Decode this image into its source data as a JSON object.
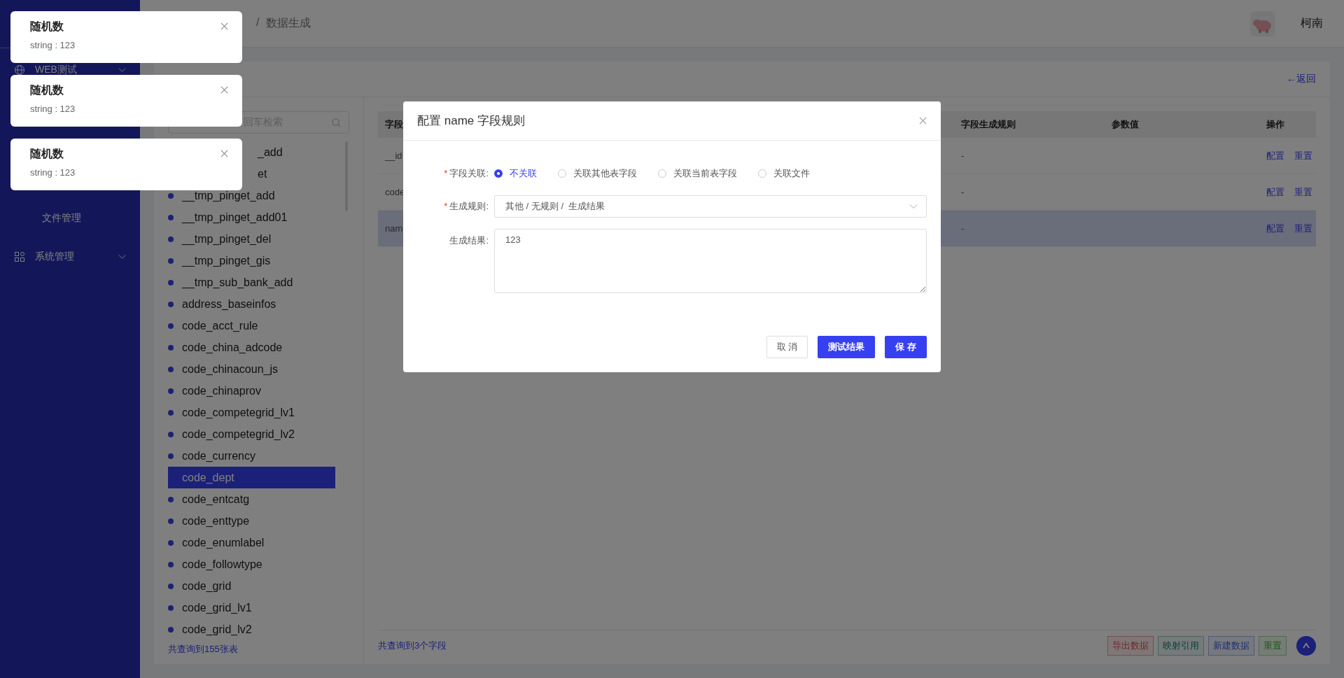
{
  "header": {
    "breadcrumb": [
      "/",
      "数据生成"
    ],
    "user": "柯南"
  },
  "sidebar": {
    "items": [
      {
        "label": "WEB测试",
        "kind": "group",
        "expanded": false
      },
      {
        "label": "文件管理",
        "kind": "leaf"
      },
      {
        "label": "系统管理",
        "kind": "group",
        "expanded": false
      }
    ]
  },
  "page": {
    "back_link": "←返回"
  },
  "table_list": {
    "search_placeholder": "回车检索",
    "items": [
      {
        "name": "_add",
        "kind": "covered",
        "selected": false
      },
      {
        "name": "et",
        "kind": "covered",
        "selected": false
      },
      {
        "name": "__tmp_pinget_add",
        "kind": "table",
        "selected": false
      },
      {
        "name": "__tmp_pinget_add01",
        "kind": "table",
        "selected": false
      },
      {
        "name": "__tmp_pinget_del",
        "kind": "table",
        "selected": false
      },
      {
        "name": "__tmp_pinget_gis",
        "kind": "table",
        "selected": false
      },
      {
        "name": "__tmp_sub_bank_add",
        "kind": "table",
        "selected": false
      },
      {
        "name": "address_baseinfos",
        "kind": "table",
        "selected": false
      },
      {
        "name": "code_acct_rule",
        "kind": "table",
        "selected": false
      },
      {
        "name": "code_china_adcode",
        "kind": "table",
        "selected": false
      },
      {
        "name": "code_chinacoun_js",
        "kind": "table",
        "selected": false
      },
      {
        "name": "code_chinaprov",
        "kind": "table",
        "selected": false
      },
      {
        "name": "code_competegrid_lv1",
        "kind": "table",
        "selected": false
      },
      {
        "name": "code_competegrid_lv2",
        "kind": "table",
        "selected": false
      },
      {
        "name": "code_currency",
        "kind": "table",
        "selected": false
      },
      {
        "name": "code_dept",
        "kind": "table",
        "selected": true
      },
      {
        "name": "code_entcatg",
        "kind": "table",
        "selected": false
      },
      {
        "name": "code_enttype",
        "kind": "table",
        "selected": false
      },
      {
        "name": "code_enumlabel",
        "kind": "table",
        "selected": false
      },
      {
        "name": "code_followtype",
        "kind": "table",
        "selected": false
      },
      {
        "name": "code_grid",
        "kind": "table",
        "selected": false
      },
      {
        "name": "code_grid_lv1",
        "kind": "table",
        "selected": false
      },
      {
        "name": "code_grid_lv2",
        "kind": "table",
        "selected": false
      }
    ],
    "count": "共查询到155张表"
  },
  "fields_table": {
    "columns": [
      "字段",
      "字段生成规则",
      "参数值",
      "操作"
    ],
    "rows": [
      {
        "field": "__id",
        "rule": "-",
        "selected": false,
        "actions": [
          "配置",
          "重置"
        ]
      },
      {
        "field": "code",
        "rule": "-",
        "selected": false,
        "actions": [
          "配置",
          "重置"
        ]
      },
      {
        "field": "nam",
        "rule": "-",
        "selected": true,
        "actions": [
          "配置",
          "重置"
        ]
      }
    ],
    "count": "共查询到3个字段",
    "buttons": [
      {
        "label": "导出数据",
        "kind": "danger"
      },
      {
        "label": "映射引用",
        "kind": "info"
      },
      {
        "label": "新建数据",
        "kind": "primary"
      },
      {
        "label": "重置",
        "kind": "success"
      }
    ]
  },
  "modal": {
    "title": "配置 name 字段规则",
    "relation": {
      "label": "字段关联:",
      "marker": "*",
      "options": [
        {
          "label": "不关联",
          "selected": true
        },
        {
          "label": "关联其他表字段",
          "selected": false
        },
        {
          "label": "关联当前表字段",
          "selected": false
        },
        {
          "label": "关联文件",
          "selected": false
        }
      ]
    },
    "rule": {
      "label": "生成规则:",
      "marker": "*",
      "value": "其他 / 无规则 /  生成结果"
    },
    "result": {
      "label": "生成结果:",
      "value": "123"
    },
    "buttons": [
      {
        "label": "取 消",
        "kind": "default"
      },
      {
        "label": "测试结果",
        "kind": "primary"
      },
      {
        "label": "保 存",
        "kind": "primary"
      }
    ]
  },
  "notifications": [
    {
      "title": "随机数",
      "message": "string : 123"
    },
    {
      "title": "随机数",
      "message": "string : 123"
    },
    {
      "title": "随机数",
      "message": "string : 123"
    }
  ]
}
